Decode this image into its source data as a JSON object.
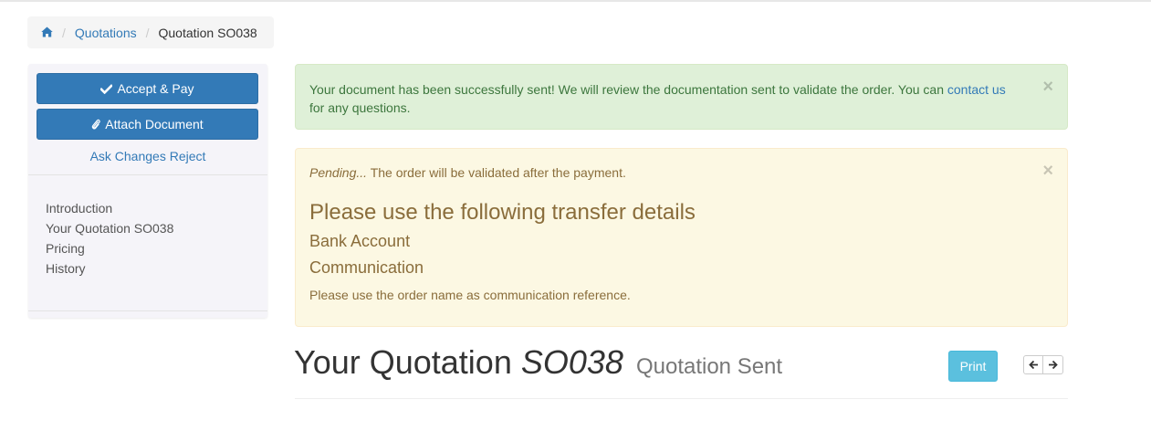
{
  "breadcrumb": {
    "home_icon": "home-icon",
    "quotations_label": "Quotations",
    "current_label": "Quotation SO038"
  },
  "sidebar": {
    "accept_pay_label": "Accept & Pay",
    "attach_document_label": "Attach Document",
    "ask_changes_label": "Ask Changes",
    "reject_label": "Reject",
    "nav_items": [
      {
        "label": "Introduction"
      },
      {
        "label": "Your Quotation SO038"
      },
      {
        "label": "Pricing"
      },
      {
        "label": "History"
      }
    ]
  },
  "alert_success": {
    "text_before": "Your document has been successfully sent! We will review the documentation sent to validate the order. You can ",
    "link_text": "contact us",
    "text_after": " for any questions.",
    "close": "×"
  },
  "alert_warning": {
    "pending_label": "Pending...",
    "pending_text": " The order will be validated after the payment.",
    "title": "Please use the following transfer details",
    "bank_account": "Bank Account",
    "communication": "Communication",
    "note": "Please use the order name as communication reference.",
    "close": "×"
  },
  "heading": {
    "prefix": "Your Quotation ",
    "number": "SO038",
    "status": "Quotation Sent"
  },
  "print_label": "Print",
  "colors": {
    "primary": "#337ab7",
    "success_bg": "#dff0d8",
    "warning_bg": "#fcf8e3",
    "info": "#5bc0de"
  }
}
